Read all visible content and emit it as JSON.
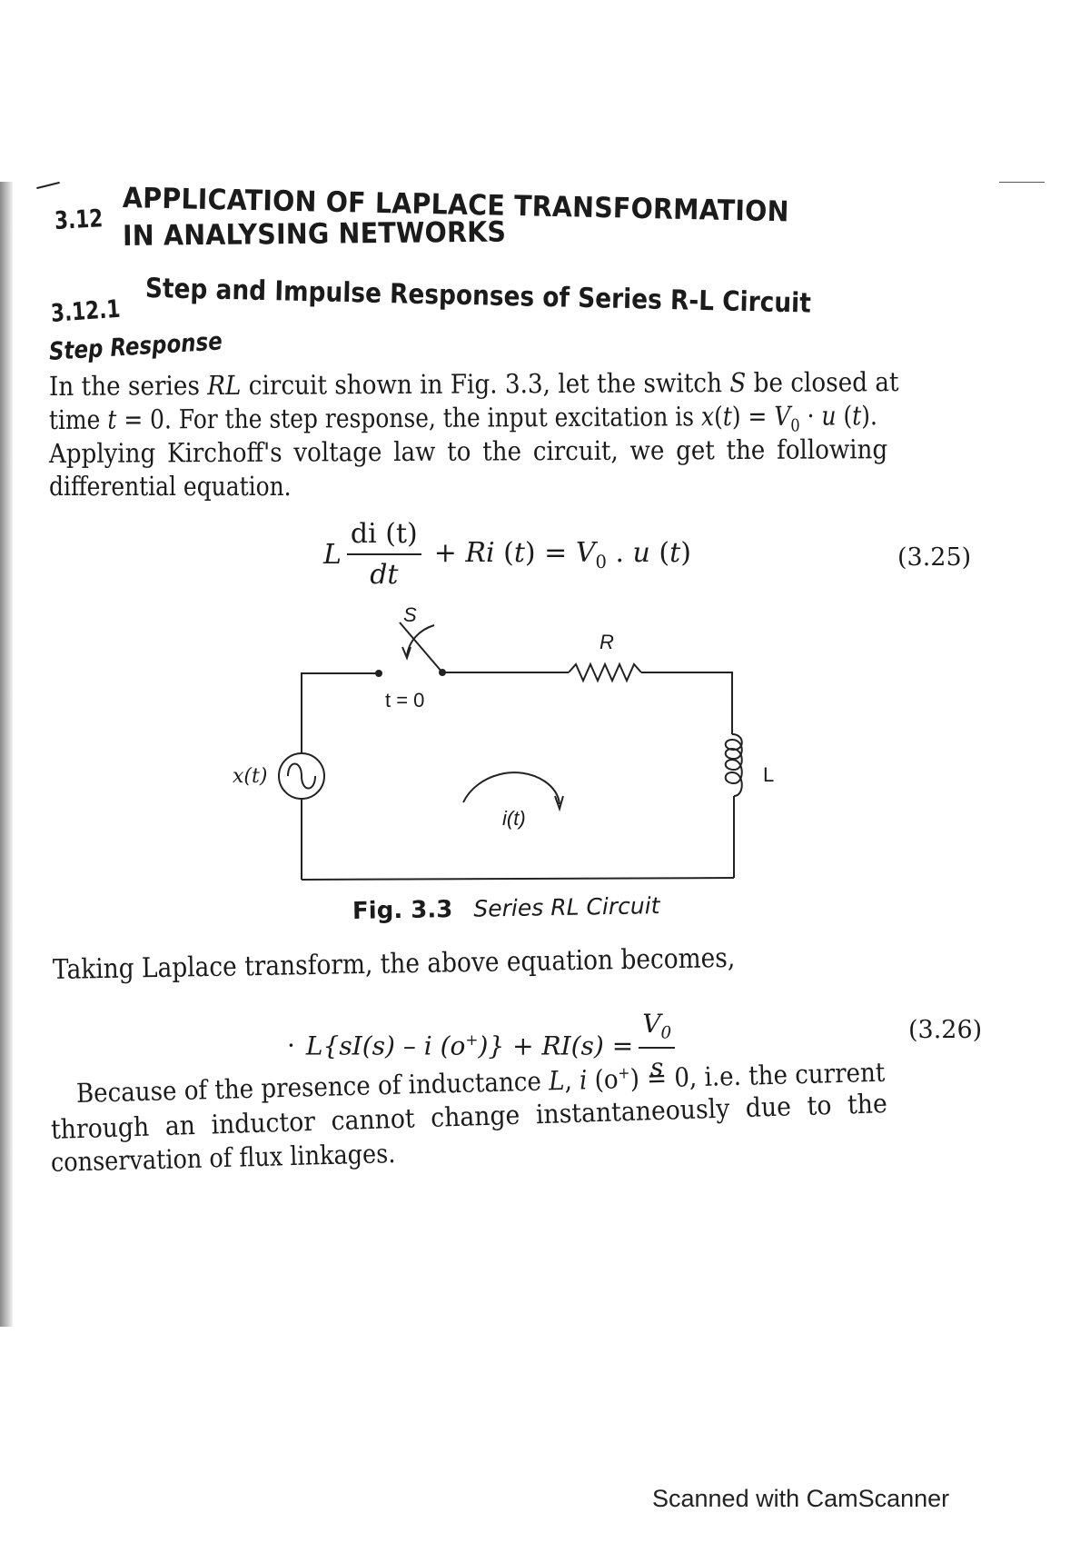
{
  "section": {
    "number": "3.12",
    "title_line1": "APPLICATION OF LAPLACE TRANSFORMATION",
    "title_line2": "IN ANALYSING NETWORKS"
  },
  "subsection": {
    "number": "3.12.1",
    "title": "Step and Impulse Responses of Series R-L Circuit"
  },
  "subheading": "Step Response",
  "paragraph1": {
    "line1_a": "In the series ",
    "line1_rl": "RL",
    "line1_b": " circuit shown in Fig. 3.3, let the switch ",
    "line1_s": "S",
    "line1_c": " be closed at",
    "line2_a": "time ",
    "line2_t": "t",
    "line2_b": " = 0. For the step response, the input excitation is ",
    "line2_x": "x",
    "line2_c": "(",
    "line2_t2": "t",
    "line2_d": ") = ",
    "line2_v": "V",
    "line2_sub": "0",
    "line2_e": " · ",
    "line2_u": "u",
    "line2_f": " (",
    "line2_t3": "t",
    "line2_g": ").",
    "line3": "Applying Kirchoff's voltage law to the circuit, we get the following",
    "line4": "differential equation."
  },
  "equation1": {
    "lhs_L": "L",
    "frac_num": "di (t)",
    "frac_den": "dt",
    "rest_a": "+ ",
    "rest_R": "Ri",
    "rest_b": " (",
    "rest_t": "t",
    "rest_c": ") = ",
    "rest_V": "V",
    "rest_sub": "0",
    "rest_d": " . ",
    "rest_u": "u",
    "rest_e": " (",
    "rest_t2": "t",
    "rest_f": ")",
    "number": "(3.25)"
  },
  "figure": {
    "switch_label": "S",
    "switch_time_label": "t = 0",
    "resistor_label": "R",
    "inductor_label": "L",
    "source_label": "x(t)",
    "current_label": "i(t)",
    "caption_num": "Fig. 3.3",
    "caption_text": "Series RL Circuit"
  },
  "paragraph2": "Taking Laplace transform, the above equation becomes,",
  "equation2": {
    "lhs": "L{sI(s) – i (o",
    "lhs_sup": "+",
    "lhs_end": ")} + RI(s) =",
    "frac_num": "V",
    "frac_num_sub": "0",
    "frac_den": "s",
    "number": "(3.26)"
  },
  "paragraph3": {
    "line1_a": "Because of the presence of inductance ",
    "line1_L": "L",
    "line1_b": ", ",
    "line1_i": "i",
    "line1_c": " (o",
    "line1_sup": "+",
    "line1_d": ") = 0, i.e. the current",
    "line2": "through an inductor cannot change instantaneously due to the",
    "line3": "conservation of flux linkages."
  },
  "watermark": "Scanned with CamScanner"
}
